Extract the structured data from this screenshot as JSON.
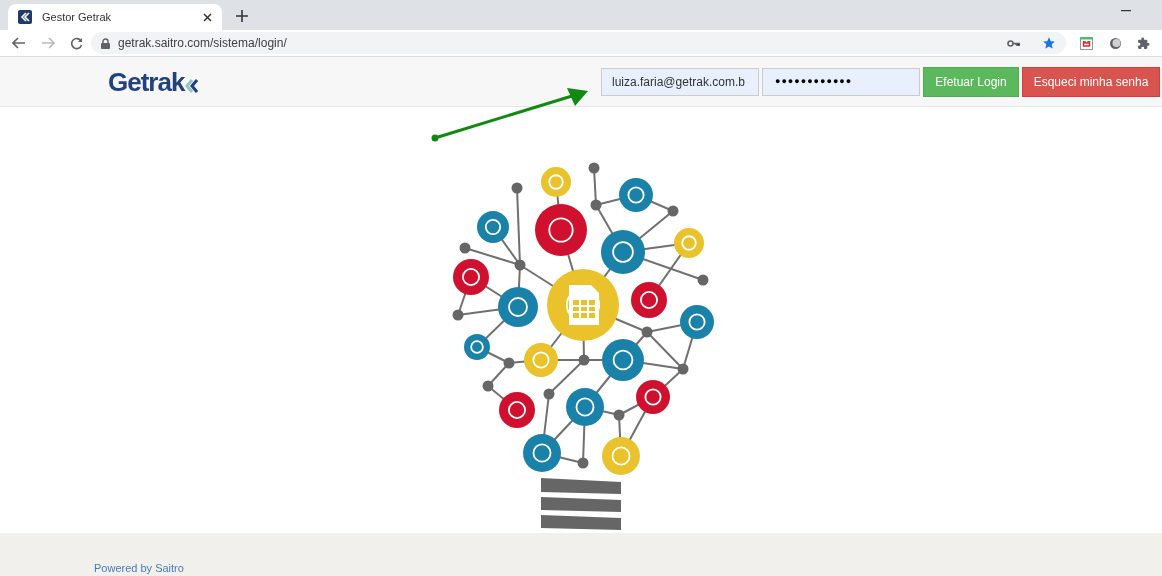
{
  "browser": {
    "tab_title": "Gestor Getrak",
    "url": "getrak.saitro.com/sistema/login/"
  },
  "header": {
    "logo_text": "Getrak",
    "email": {
      "value": "luiza.faria@getrak.com.b"
    },
    "password": {
      "value": "●●●●●●●●●●●●"
    },
    "buttons": [
      {
        "label": "Efetuar Login",
        "kind": "primary"
      },
      {
        "label": "Esqueci minha senha",
        "kind": "danger"
      }
    ]
  },
  "footer": {
    "text": "Powered by Saitro"
  }
}
